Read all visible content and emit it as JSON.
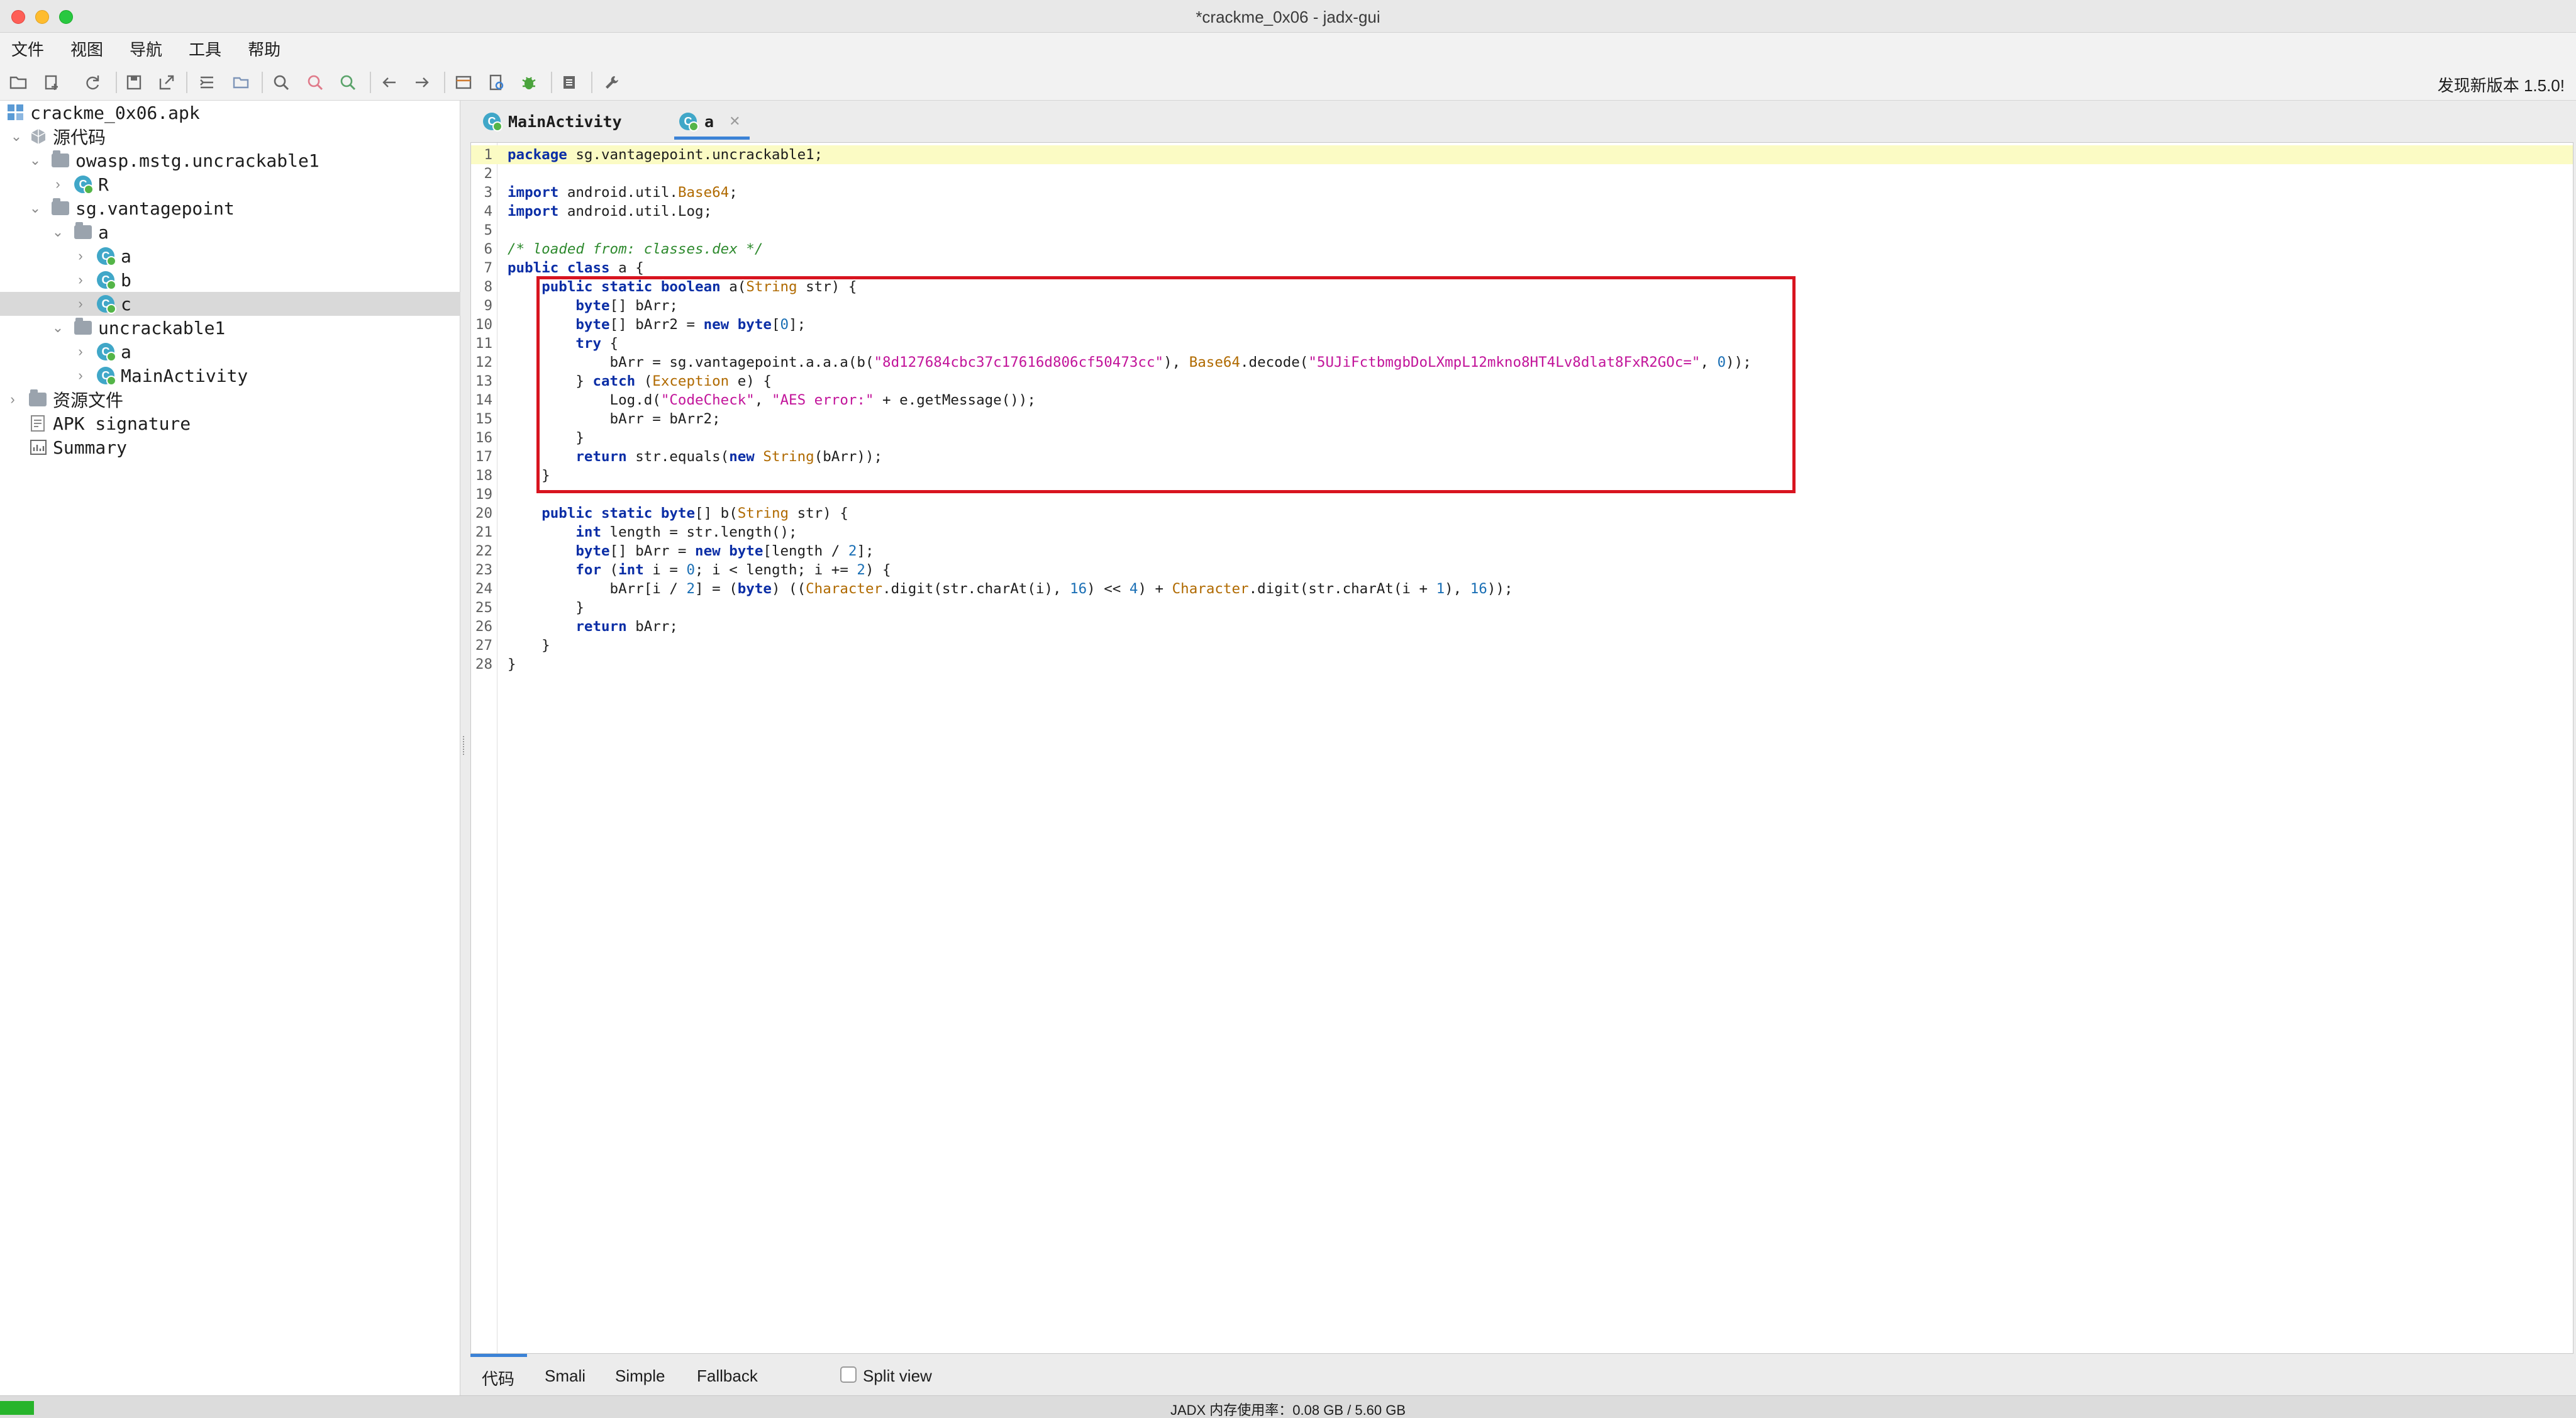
{
  "window": {
    "title": "*crackme_0x06 - jadx-gui"
  },
  "menu": [
    "文件",
    "视图",
    "导航",
    "工具",
    "帮助"
  ],
  "toolbar": {
    "update_notice": "发现新版本 1.5.0!"
  },
  "tree": [
    {
      "label": "crackme_0x06.apk",
      "icon": "apk-icon"
    },
    {
      "label": "源代码",
      "icon": "source-icon"
    },
    {
      "label": "owasp.mstg.uncrackable1",
      "icon": "package-icon"
    },
    {
      "label": "R",
      "icon": "class-icon"
    },
    {
      "label": "sg.vantagepoint",
      "icon": "package-icon"
    },
    {
      "label": "a",
      "icon": "package-icon"
    },
    {
      "label": "a",
      "icon": "class-icon"
    },
    {
      "label": "b",
      "icon": "class-icon"
    },
    {
      "label": "c",
      "icon": "class-icon"
    },
    {
      "label": "uncrackable1",
      "icon": "package-icon"
    },
    {
      "label": "a",
      "icon": "class-icon"
    },
    {
      "label": "MainActivity",
      "icon": "class-icon"
    },
    {
      "label": "资源文件",
      "icon": "resources-icon"
    },
    {
      "label": "APK signature",
      "icon": "signature-icon"
    },
    {
      "label": "Summary",
      "icon": "summary-icon"
    }
  ],
  "tabs": [
    {
      "label": "MainActivity",
      "active": false
    },
    {
      "label": "a",
      "active": true
    }
  ],
  "code": {
    "line_numbers": [
      "1",
      "2",
      "3",
      "4",
      "5",
      "6",
      "7",
      "8",
      "9",
      "10",
      "11",
      "12",
      "13",
      "14",
      "15",
      "16",
      "17",
      "18",
      "19",
      "20",
      "21",
      "22",
      "23",
      "24",
      "25",
      "26",
      "27",
      "28"
    ],
    "lines": [
      "package sg.vantagepoint.uncrackable1;",
      "",
      "import android.util.Base64;",
      "import android.util.Log;",
      "",
      "/* loaded from: classes.dex */",
      "public class a {",
      "    public static boolean a(String str) {",
      "        byte[] bArr;",
      "        byte[] bArr2 = new byte[0];",
      "        try {",
      "            bArr = sg.vantagepoint.a.a.a(b(\"8d127684cbc37c17616d806cf50473cc\"), Base64.decode(\"5UJiFctbmgbDoLXmpL12mkno8HT4Lv8dlat8FxR2GOc=\", 0));",
      "        } catch (Exception e) {",
      "            Log.d(\"CodeCheck\", \"AES error:\" + e.getMessage());",
      "            bArr = bArr2;",
      "        }",
      "        return str.equals(new String(bArr));",
      "    }",
      "",
      "    public static byte[] b(String str) {",
      "        int length = str.length();",
      "        byte[] bArr = new byte[length / 2];",
      "        for (int i = 0; i < length; i += 2) {",
      "            bArr[i / 2] = (byte) ((Character.digit(str.charAt(i), 16) << 4) + Character.digit(str.charAt(i + 1), 16));",
      "        }",
      "        return bArr;",
      "    }",
      "}"
    ]
  },
  "view_tabs": [
    "代码",
    "Smali",
    "Simple",
    "Fallback"
  ],
  "split_view": {
    "label": "Split view",
    "checked": false
  },
  "status": {
    "memory": "JADX 内存使用率：0.08 GB / 5.60 GB"
  }
}
